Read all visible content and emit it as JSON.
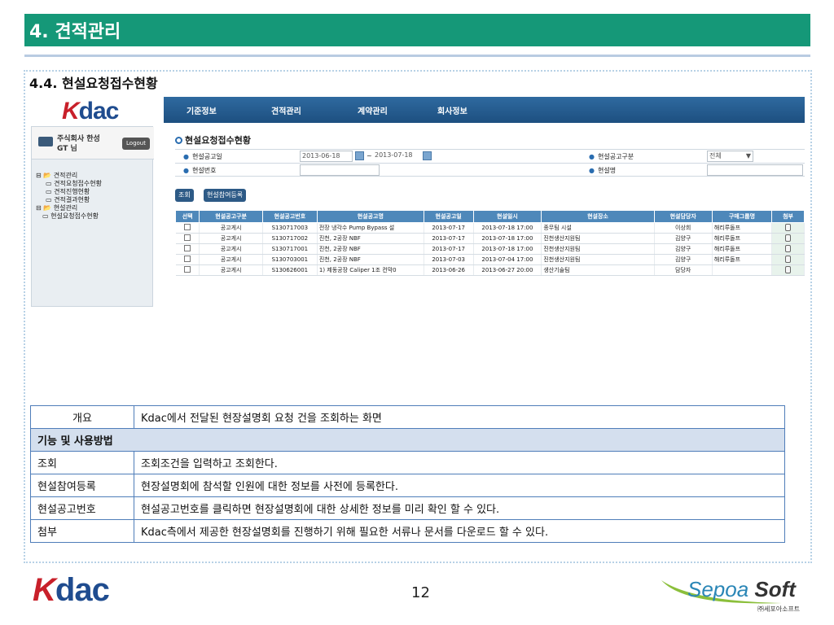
{
  "slide": {
    "title": "4. 견적관리",
    "section_title": "4.4. 현설요청접수현황",
    "page_number": "12"
  },
  "app": {
    "logo_k": "K",
    "logo_rest": "dac",
    "nav": [
      "기준정보",
      "견적관리",
      "계약관리",
      "회사정보"
    ],
    "user": {
      "company": "주식회사 한성",
      "name": "GT 님",
      "logout": "Logout"
    },
    "tree": [
      {
        "label": "견적관리",
        "level": 1
      },
      {
        "label": "견적요청접수현황",
        "level": 2
      },
      {
        "label": "견적진행현황",
        "level": 2
      },
      {
        "label": "견적결과현황",
        "level": 2
      },
      {
        "label": "현설관리",
        "level": 1
      },
      {
        "label": "현설요청접수현황",
        "level": 2
      }
    ],
    "page_title": "현설요청접수현황",
    "form": {
      "date_label": "현설공고일",
      "date_from": "2013-06-18",
      "date_sep": "~",
      "date_to": "2013-07-18",
      "type_label": "현설공고구분",
      "type_value": "전체",
      "number_label": "현설번호",
      "name_label": "현설명"
    },
    "buttons": {
      "search": "조회",
      "register": "현설참여등록"
    },
    "grid": {
      "headers": [
        "선택",
        "현설공고구분",
        "현설공고번호",
        "현설공고명",
        "현설공고일",
        "현설일시",
        "현설장소",
        "현설담당자",
        "구매그룹명",
        "첨부"
      ],
      "rows": [
        [
          "공고게시",
          "S130717003",
          "전장 냉각수 Pump Bypass 설",
          "2013-07-17",
          "2013-07-18 17:00",
          "종무팀 시설",
          "이상희",
          "해리루돌프"
        ],
        [
          "공고게시",
          "S130717002",
          "진천, 2공장 NBF",
          "2013-07-17",
          "2013-07-18 17:00",
          "진천생산지원팀",
          "김양구",
          "해리루돌프"
        ],
        [
          "공고게시",
          "S130717001",
          "진천, 2공장 NBF",
          "2013-07-17",
          "2013-07-18 17:00",
          "진천생산지원팀",
          "김양구",
          "해리루돌프"
        ],
        [
          "공고게시",
          "S130703001",
          "진천, 2공장 NBF",
          "2013-07-03",
          "2013-07-04 17:00",
          "진천생산지원팀",
          "김양구",
          "해리루돌프"
        ],
        [
          "공고게시",
          "S130626001",
          "1) 제동공장 Caliper 1조 컨막0",
          "2013-06-26",
          "2013-06-27 20:00",
          "생산기술팀",
          "담당자",
          ""
        ]
      ]
    }
  },
  "description": {
    "overview_key": "개요",
    "overview_value": "Kdac에서 전달된 현장설명회 요청 건을 조회하는 화면",
    "section_header": "기능 및 사용방법",
    "rows": [
      {
        "key": "조회",
        "value": "조회조건을 입력하고 조회한다."
      },
      {
        "key": "현설참여등록",
        "value": "현장설명회에 참석할 인원에 대한 정보를 사전에 등록한다."
      },
      {
        "key": "현설공고번호",
        "value": "현설공고번호를 클릭하면 현장설명회에 대한 상세한 정보를 미리 확인 할 수 있다."
      },
      {
        "key": "첨부",
        "value": "Kdac측에서 제공한 현장설명회를 진행하기 위해 필요한 서류나 문서를 다운로드 할 수 있다."
      }
    ]
  },
  "footer": {
    "logo_k": "K",
    "logo_rest": "dac",
    "sepoa_main": "Sepoa ",
    "sepoa_bold": "Soft",
    "sepoa_sub": "㈜세포아소프트"
  },
  "colors": {
    "title_bar": "#159878",
    "nav_blue": "#2f6aa0",
    "grid_header": "#4e88ba",
    "table_border": "#4f7db9"
  }
}
